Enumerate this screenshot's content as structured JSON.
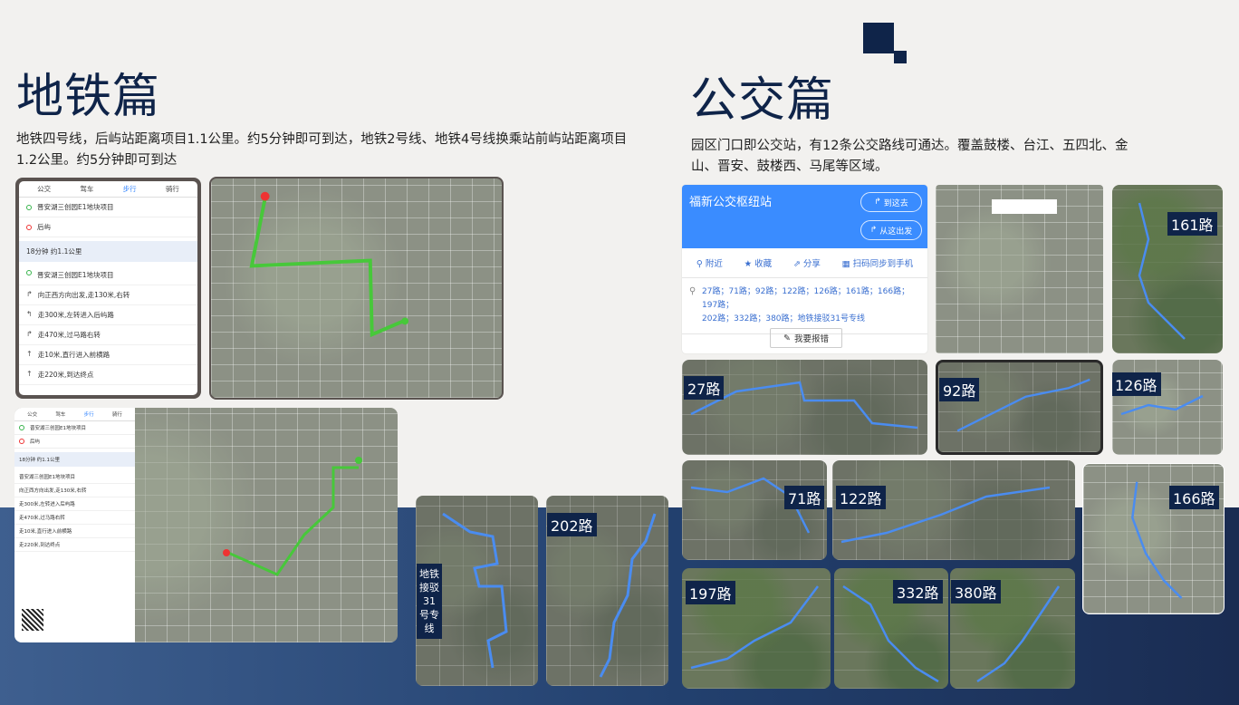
{
  "metro": {
    "title": "地铁篇",
    "description_line1": "地铁四号线，后屿站距离项目1.1公里。约5分钟即可到达，地铁2号线、地铁4号线换乘站前屿站距离项目",
    "description_line2": "1.2公里。约5分钟即可到达",
    "directions_panel": {
      "tabs": [
        "公交",
        "驾车",
        "步行",
        "骑行"
      ],
      "active_tab": "步行",
      "origin": "晋安湖三创园E1地块项目",
      "destination": "后屿",
      "summary": "18分钟    约1.1公里",
      "steps": [
        "晋安湖三创园E1地块项目",
        "向正西方向出发,走130米,右转",
        "走300米,左转进入后屿路",
        "走470米,过马路右转",
        "走10米,直行进入前横路",
        "走220米,到达终点"
      ]
    },
    "route_31_label": "地铁接驳31号专线",
    "route_202_label": "202路"
  },
  "bus": {
    "title": "公交篇",
    "description_line1": "园区门口即公交站，有12条公交路线可通达。覆盖鼓楼、台江、五四北、金",
    "description_line2": "山、晋安、鼓楼西、马尾等区域。",
    "station_card": {
      "name": "福新公交枢纽站",
      "btn_go": "到这去",
      "btn_from": "从这出发",
      "actions": [
        "附近",
        "收藏",
        "分享",
        "扫码同步到手机"
      ],
      "routes_line1": "27路；71路；92路；122路；126路；161路；166路；197路；",
      "routes_line2": "202路；332路；380路；地铁接驳31号专线",
      "report": "我要报错"
    },
    "route_labels": {
      "r161": "161路",
      "r27": "27路",
      "r92": "92路",
      "r126": "126路",
      "r71": "71路",
      "r122": "122路",
      "r166": "166路",
      "r197": "197路",
      "r332": "332路",
      "r380": "380路"
    }
  },
  "colors": {
    "title": "#0f2449",
    "band": "#22406e",
    "route_green": "#47c83a",
    "route_blue": "#4a8cf0",
    "accent_blue": "#3a8cff"
  }
}
